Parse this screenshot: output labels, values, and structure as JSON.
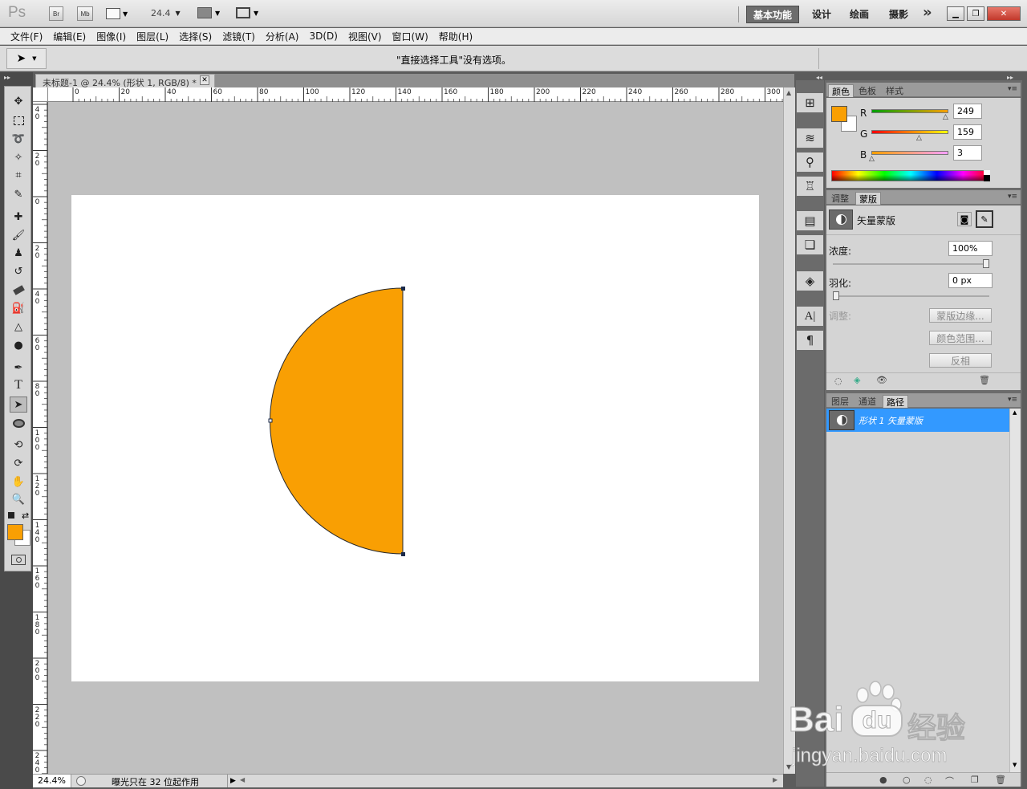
{
  "app": {
    "logo": "Ps",
    "bridge_label": "Br",
    "minibridge_label": "Mb",
    "zoom_value": "24.4",
    "workspaces": [
      "基本功能",
      "设计",
      "绘画",
      "摄影"
    ],
    "more_glyph": "»"
  },
  "menubar": [
    "文件(F)",
    "编辑(E)",
    "图像(I)",
    "图层(L)",
    "选择(S)",
    "滤镜(T)",
    "分析(A)",
    "3D(D)",
    "视图(V)",
    "窗口(W)",
    "帮助(H)"
  ],
  "options": {
    "message": "\"直接选择工具\"没有选项。"
  },
  "document": {
    "tab_title": "未标题-1 @ 24.4% (形状 1, RGB/8) *",
    "shape_color": "#F99F03",
    "hruler_labels": [
      "0",
      "20",
      "40",
      "60",
      "80",
      "100",
      "120",
      "140",
      "160",
      "180",
      "200",
      "220",
      "240",
      "260",
      "280",
      "300"
    ],
    "vruler_labels": [
      [
        "4",
        "0"
      ],
      [
        "2",
        "0"
      ],
      [
        "0"
      ],
      [
        "2",
        "0"
      ],
      [
        "4",
        "0"
      ],
      [
        "6",
        "0"
      ],
      [
        "8",
        "0"
      ],
      [
        "1",
        "0",
        "0"
      ],
      [
        "1",
        "2",
        "0"
      ],
      [
        "1",
        "4",
        "0"
      ],
      [
        "1",
        "6",
        "0"
      ],
      [
        "1",
        "8",
        "0"
      ],
      [
        "2",
        "0",
        "0"
      ],
      [
        "2",
        "2",
        "0"
      ],
      [
        "2",
        "4",
        "0"
      ]
    ]
  },
  "status": {
    "zoom": "24.4%",
    "info": "曝光只在 32 位起作用"
  },
  "color_panel": {
    "tabs": [
      "颜色",
      "色板",
      "样式"
    ],
    "fg_color": "#F99F03",
    "bg_color": "#FFFFFF",
    "channels": [
      {
        "label": "R",
        "value": "249"
      },
      {
        "label": "G",
        "value": "159"
      },
      {
        "label": "B",
        "value": "3"
      }
    ]
  },
  "masks_panel": {
    "tabs": [
      "调整",
      "蒙版"
    ],
    "mask_type": "矢量蒙版",
    "density_label": "浓度:",
    "density_value": "100%",
    "density_level": 1.0,
    "feather_label": "羽化:",
    "feather_value": "0 px",
    "feather_level": 0.0,
    "refine_label": "调整:",
    "buttons": [
      "蒙版边缘...",
      "颜色范围...",
      "反相"
    ]
  },
  "paths_panel": {
    "tabs": [
      "图层",
      "通道",
      "路径"
    ],
    "items": [
      {
        "name": "形状 1 矢量蒙版",
        "selected": true
      }
    ]
  },
  "watermark": {
    "brand": "Bai",
    "brand2": "du",
    "cn": "经验",
    "url": "jingyan.baidu.com"
  }
}
